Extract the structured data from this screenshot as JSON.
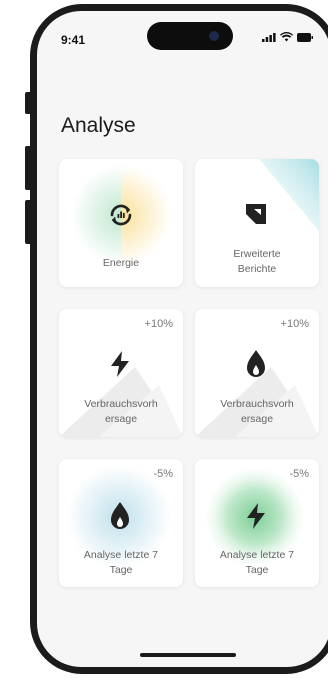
{
  "status": {
    "time": "9:41"
  },
  "page": {
    "title": "Analyse"
  },
  "cards": [
    {
      "label": "Energie",
      "icon": "energy-cycle-icon"
    },
    {
      "label": "Erweiterte Berichte",
      "icon": "report-icon"
    },
    {
      "label": "Verbrauchsvorhersage",
      "icon": "lightning-icon",
      "change": "+10%"
    },
    {
      "label": "Verbrauchsvorhersage",
      "icon": "gas-flame-icon",
      "change": "+10%"
    },
    {
      "label": "Analyse letzte 7 Tage",
      "icon": "gas-flame-icon",
      "change": "-5%"
    },
    {
      "label": "Analyse letzte 7 Tage",
      "icon": "lightning-icon",
      "change": "-5%"
    }
  ],
  "colors": {
    "energy_green": "#c9ead6",
    "energy_yellow": "#fbe6a8",
    "blue_glow": "#cfe6ef",
    "green_glow": "#8fd4a4",
    "teal_accent": "#bfe6ea"
  }
}
